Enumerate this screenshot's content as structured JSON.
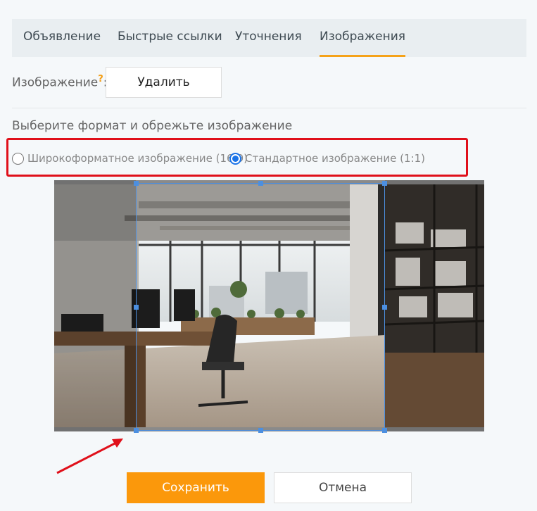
{
  "tabs": [
    {
      "label": "Объявление",
      "active": false
    },
    {
      "label": "Быстрые ссылки",
      "active": false
    },
    {
      "label": "Уточнения",
      "active": false
    },
    {
      "label": "Изображения",
      "active": true
    }
  ],
  "image_section": {
    "label": "Изображение",
    "help_mark": "?",
    "colon": ":",
    "delete_label": "Удалить"
  },
  "format": {
    "title": "Выберите формат и обрежьте изображение",
    "options": [
      {
        "label": "Широкоформатное изображение (16:9)",
        "checked": false
      },
      {
        "label": "Стандартное изображение (1:1)",
        "checked": true
      }
    ]
  },
  "actions": {
    "save_label": "Сохранить",
    "cancel_label": "Отмена"
  },
  "colors": {
    "accent": "#fb980b",
    "tab_underline": "#f5a219",
    "crop_frame": "#4c8fe0",
    "radio_selected": "#1a73e8",
    "annotation": "#e0101a"
  }
}
